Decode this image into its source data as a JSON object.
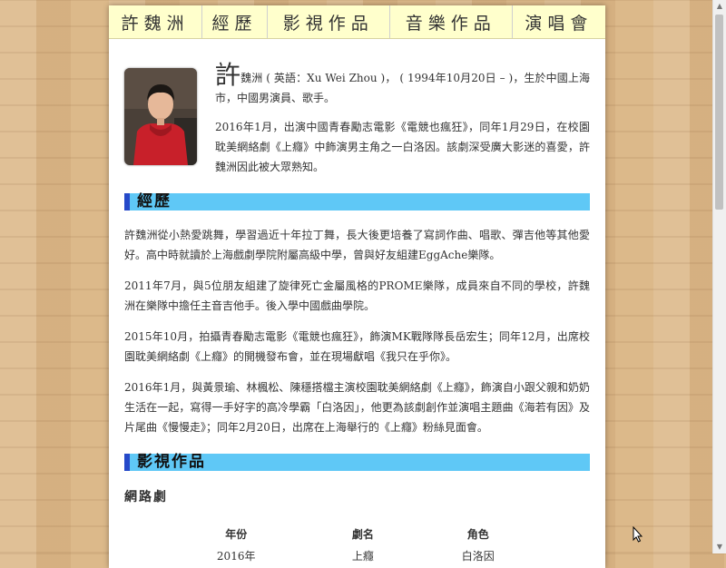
{
  "nav": [
    {
      "label": "許魏洲"
    },
    {
      "label": "經歷"
    },
    {
      "label": "影視作品"
    },
    {
      "label": "音樂作品"
    },
    {
      "label": "演唱會"
    }
  ],
  "intro": {
    "big_char": "許",
    "p1": "魏洲 ( 英語：Xu Wei Zhou )， ( 1994年10月20日 – )，生於中國上海市，中國男演員、歌手。",
    "p2": "2016年1月，出演中國青春勵志電影《電競也瘋狂》，同年1月29日，在校園耽美網絡劇《上癮》中飾演男主角之一白洛因。該劇深受廣大影迷的喜愛，許魏洲因此被大眾熟知。"
  },
  "experience": {
    "title": "經歷",
    "paragraphs": [
      "許魏洲從小熱愛跳舞，學習過近十年拉丁舞，長大後更培養了寫詞作曲、唱歌、彈吉他等其他愛好。高中時就讀於上海戲劇學院附屬高級中學，曾與好友組建EggAche樂隊。",
      "2011年7月，與5位朋友組建了旋律死亡金屬風格的PROME樂隊，成員來自不同的學校，許魏洲在樂隊中擔任主音吉他手。後入學中國戲曲學院。",
      "2015年10月，拍攝青春勵志電影《電競也瘋狂》，飾演MK戰隊隊長岳宏生；同年12月，出席校園耽美網絡劇《上癮》的開機發布會，並在現場獻唱《我只在乎你》。",
      "2016年1月，與黃景瑜、林楓松、陳穩搭檔主演校園耽美網絡劇《上癮》，飾演自小跟父親和奶奶生活在一起，寫得一手好字的高冷學霸「白洛因」，他更為該劇創作並演唱主題曲《海若有因》及片尾曲《慢慢走》；同年2月20日，出席在上海舉行的《上癮》粉絲見面會。"
    ]
  },
  "works": {
    "title": "影視作品",
    "subhead": "網路劇",
    "columns": [
      "年份",
      "劇名",
      "角色"
    ],
    "rows": [
      [
        "2016年",
        "上癮",
        "白洛因"
      ]
    ]
  },
  "colors": {
    "section_bar": "#5fc8f6",
    "section_accent": "#2649c9",
    "nav_bg": "#ffffcc"
  }
}
